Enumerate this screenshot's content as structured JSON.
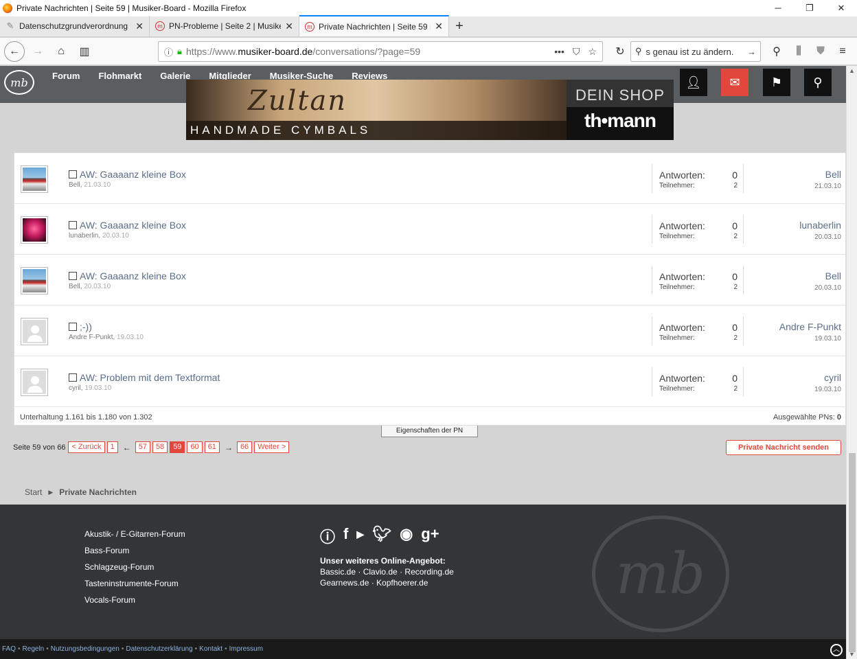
{
  "window": {
    "title": "Private Nachrichten | Seite 59 | Musiker-Board - Mozilla Firefox",
    "minimize": "─",
    "maximize": "❐",
    "close": "✕"
  },
  "tabs": [
    {
      "label": "Datenschutzgrundverordnung",
      "active": false
    },
    {
      "label": "PN-Probleme | Seite 2 | Musike",
      "active": false
    },
    {
      "label": "Private Nachrichten | Seite 59 |",
      "active": true
    }
  ],
  "newtab": "+",
  "nav": {
    "url_prefix": "https://www.",
    "url_host": "musiker-board.de",
    "url_path": "/conversations/?page=59",
    "search_value": "s genau ist zu ändern."
  },
  "site_nav": [
    "Forum",
    "Flohmarkt",
    "Galerie",
    "Mitglieder",
    "Musiker-Suche",
    "Reviews"
  ],
  "logo_text": "mb",
  "banner": {
    "brand": "Zultan",
    "tagline": "HANDMADE CYMBALS",
    "shop": "DEIN SHOP",
    "shop_brand": "th•mann"
  },
  "conversations": [
    {
      "subject": "AW: Gaaaanz kleine Box",
      "starter": "Bell",
      "start_date": "21.03.10",
      "antworten_label": "Antworten:",
      "antworten": "0",
      "teilnehmer_label": "Teilnehmer:",
      "teilnehmer": "2",
      "last_user": "Bell",
      "last_date": "21.03.10",
      "avatar": "road"
    },
    {
      "subject": "AW: Gaaaanz kleine Box",
      "starter": "lunaberlin",
      "start_date": "20.03.10",
      "antworten_label": "Antworten:",
      "antworten": "0",
      "teilnehmer_label": "Teilnehmer:",
      "teilnehmer": "2",
      "last_user": "lunaberlin",
      "last_date": "20.03.10",
      "avatar": "pink"
    },
    {
      "subject": "AW: Gaaaanz kleine Box",
      "starter": "Bell",
      "start_date": "20.03.10",
      "antworten_label": "Antworten:",
      "antworten": "0",
      "teilnehmer_label": "Teilnehmer:",
      "teilnehmer": "2",
      "last_user": "Bell",
      "last_date": "20.03.10",
      "avatar": "road"
    },
    {
      "subject": ";-))",
      "starter": "Andre F-Punkt",
      "start_date": "19.03.10",
      "antworten_label": "Antworten:",
      "antworten": "0",
      "teilnehmer_label": "Teilnehmer:",
      "teilnehmer": "2",
      "last_user": "Andre F-Punkt",
      "last_date": "19.03.10",
      "avatar": "none"
    },
    {
      "subject": "AW: Problem mit dem Textformat",
      "starter": "cyril",
      "start_date": "19.03.10",
      "antworten_label": "Antworten:",
      "antworten": "0",
      "teilnehmer_label": "Teilnehmer:",
      "teilnehmer": "2",
      "last_user": "cyril",
      "last_date": "19.03.10",
      "avatar": "none"
    }
  ],
  "list_footer": {
    "range": "Unterhaltung 1.161 bis 1.180 von 1.302",
    "selected": "Ausgewählte PNs: ",
    "selected_count": "0"
  },
  "pn_properties": "Eigenschaften der PN",
  "pager": {
    "label": "Seite 59 von 66",
    "prev": "< Zurück",
    "first": "1",
    "left_arrow": "←",
    "pages": [
      "57",
      "58",
      "59",
      "60",
      "61"
    ],
    "current": "59",
    "right_arrow": "→",
    "last": "66",
    "next": "Weiter >"
  },
  "send_button": "Private Nachricht senden",
  "breadcrumb": {
    "start": "Start",
    "current": "Private Nachrichten"
  },
  "footer": {
    "forums": [
      "Akustik- / E-Gitarren-Forum",
      "Bass-Forum",
      "Schlagzeug-Forum",
      "Tasteninstrumente-Forum",
      "Vocals-Forum"
    ],
    "offer_title": "Unser weiteres Online-Angebot:",
    "offer_line1": [
      "Bassic.de",
      "Clavio.de",
      "Recording.de"
    ],
    "offer_line2": [
      "Gearnews.de",
      "Kopfhoerer.de"
    ],
    "social": [
      "info-icon",
      "facebook-icon",
      "youtube-icon",
      "twitter-icon",
      "rss-icon",
      "googleplus-icon"
    ]
  },
  "bottom_links": [
    "FAQ",
    "Regeln",
    "Nutzungsbedingungen",
    "Datenschutzerklärung",
    "Kontakt",
    "Impressum"
  ],
  "colors": {
    "accent_red": "#e2473b",
    "header_gray": "#5b5e61",
    "footer_dark": "#333537",
    "link_blue": "#5a6e8a"
  }
}
